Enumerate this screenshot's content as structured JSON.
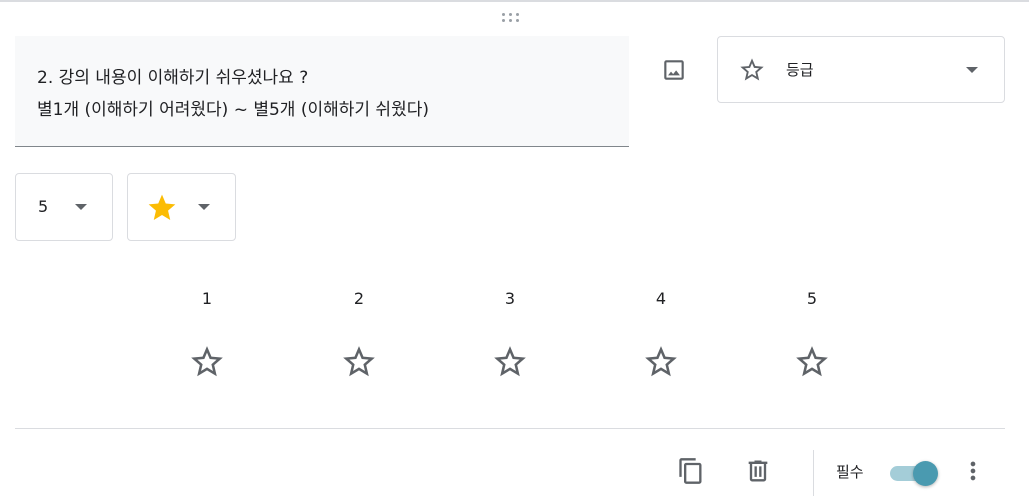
{
  "question": {
    "text": "2. 강의 내용이 이해하기 쉬우셨나요 ?\n별1개 (이해하기 어려웠다) ~ 별5개 (이해하기 쉬웠다)"
  },
  "question_type": {
    "icon": "star-outline-icon",
    "label": "등급"
  },
  "rating": {
    "count_value": "5",
    "shape_icon": "star-filled-icon",
    "shape_color": "#fbbc04",
    "scale": [
      {
        "number": "1"
      },
      {
        "number": "2"
      },
      {
        "number": "3"
      },
      {
        "number": "4"
      },
      {
        "number": "5"
      }
    ]
  },
  "footer": {
    "required_label": "필수",
    "required_on": true,
    "toggle_color": "#4a9ab0"
  }
}
